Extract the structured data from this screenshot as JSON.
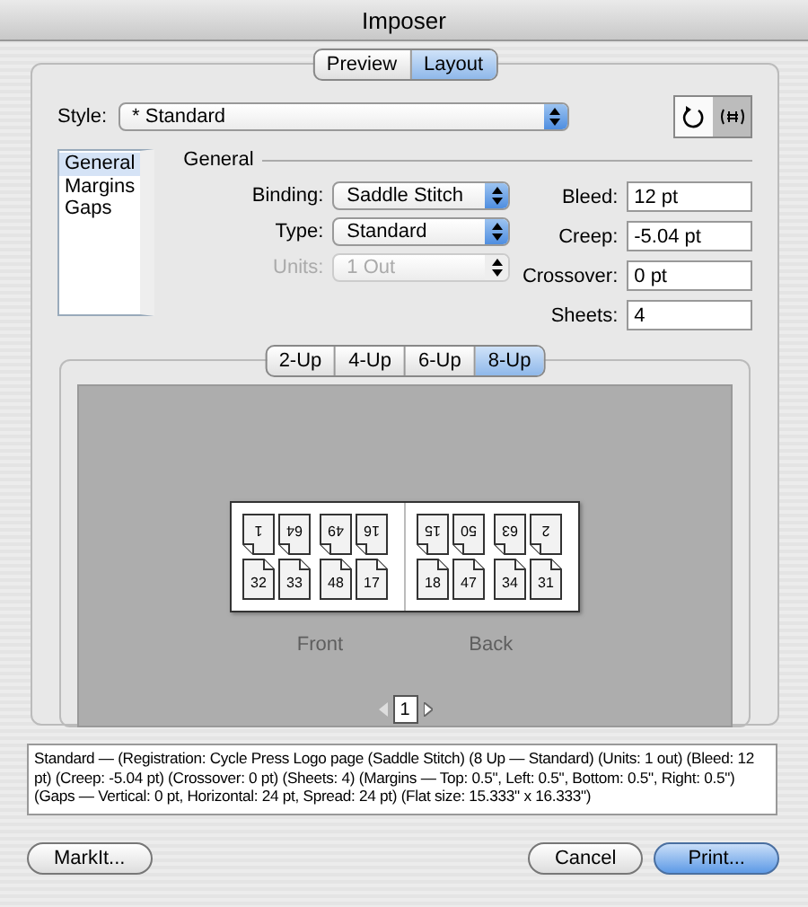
{
  "window": {
    "title": "Imposer"
  },
  "tabs": [
    {
      "label": "Preview",
      "selected": false
    },
    {
      "label": "Layout",
      "selected": true
    }
  ],
  "style": {
    "label": "Style:",
    "value": "* Standard"
  },
  "view_buttons": [
    {
      "kind": "rotate",
      "selected": false
    },
    {
      "kind": "grid",
      "selected": true
    }
  ],
  "categories": [
    {
      "label": "General",
      "selected": true
    },
    {
      "label": "Margins",
      "selected": false
    },
    {
      "label": "Gaps",
      "selected": false
    }
  ],
  "section_title": "General",
  "popups": [
    {
      "label": "Binding:",
      "value": "Saddle Stitch",
      "disabled": false
    },
    {
      "label": "Type:",
      "value": "Standard",
      "disabled": false
    },
    {
      "label": "Units:",
      "value": "1 Out",
      "disabled": true
    }
  ],
  "fields": [
    {
      "label": "Bleed:",
      "value": "12 pt"
    },
    {
      "label": "Creep:",
      "value": "-5.04 pt"
    },
    {
      "label": "Crossover:",
      "value": "0 pt"
    },
    {
      "label": "Sheets:",
      "value": "4"
    }
  ],
  "layout_tabs": [
    {
      "label": "2-Up",
      "selected": false
    },
    {
      "label": "4-Up",
      "selected": false
    },
    {
      "label": "6-Up",
      "selected": false
    },
    {
      "label": "8-Up",
      "selected": true
    }
  ],
  "sheet": {
    "sides": [
      {
        "label": "Front",
        "pages": [
          {
            "number": "1",
            "flipped": true
          },
          {
            "number": "64",
            "flipped": true
          },
          {
            "number": "49",
            "flipped": true
          },
          {
            "number": "16",
            "flipped": true
          },
          {
            "number": "32",
            "flipped": false
          },
          {
            "number": "33",
            "flipped": false
          },
          {
            "number": "48",
            "flipped": false
          },
          {
            "number": "17",
            "flipped": false
          }
        ]
      },
      {
        "label": "Back",
        "pages": [
          {
            "number": "15",
            "flipped": true
          },
          {
            "number": "50",
            "flipped": true
          },
          {
            "number": "63",
            "flipped": true
          },
          {
            "number": "2",
            "flipped": true
          },
          {
            "number": "18",
            "flipped": false
          },
          {
            "number": "47",
            "flipped": false
          },
          {
            "number": "34",
            "flipped": false
          },
          {
            "number": "31",
            "flipped": false
          }
        ]
      }
    ]
  },
  "pager": {
    "page": "1"
  },
  "description": "Standard — (Registration: Cycle Press Logo page (Saddle Stitch) (8 Up  — Standard) (Units: 1 out) (Bleed: 12 pt) (Creep: -5.04 pt) (Crossover: 0 pt) (Sheets: 4) (Margins  — Top: 0.5\", Left: 0.5\", Bottom: 0.5\", Right: 0.5\") (Gaps  — Vertical: 0 pt, Horizontal: 24 pt, Spread: 24 pt) (Flat size: 15.333\" x 16.333\")",
  "buttons": [
    {
      "label": "MarkIt...",
      "kind": "normal"
    },
    {
      "label": "Cancel",
      "kind": "normal"
    },
    {
      "label": "Print...",
      "kind": "default"
    }
  ]
}
